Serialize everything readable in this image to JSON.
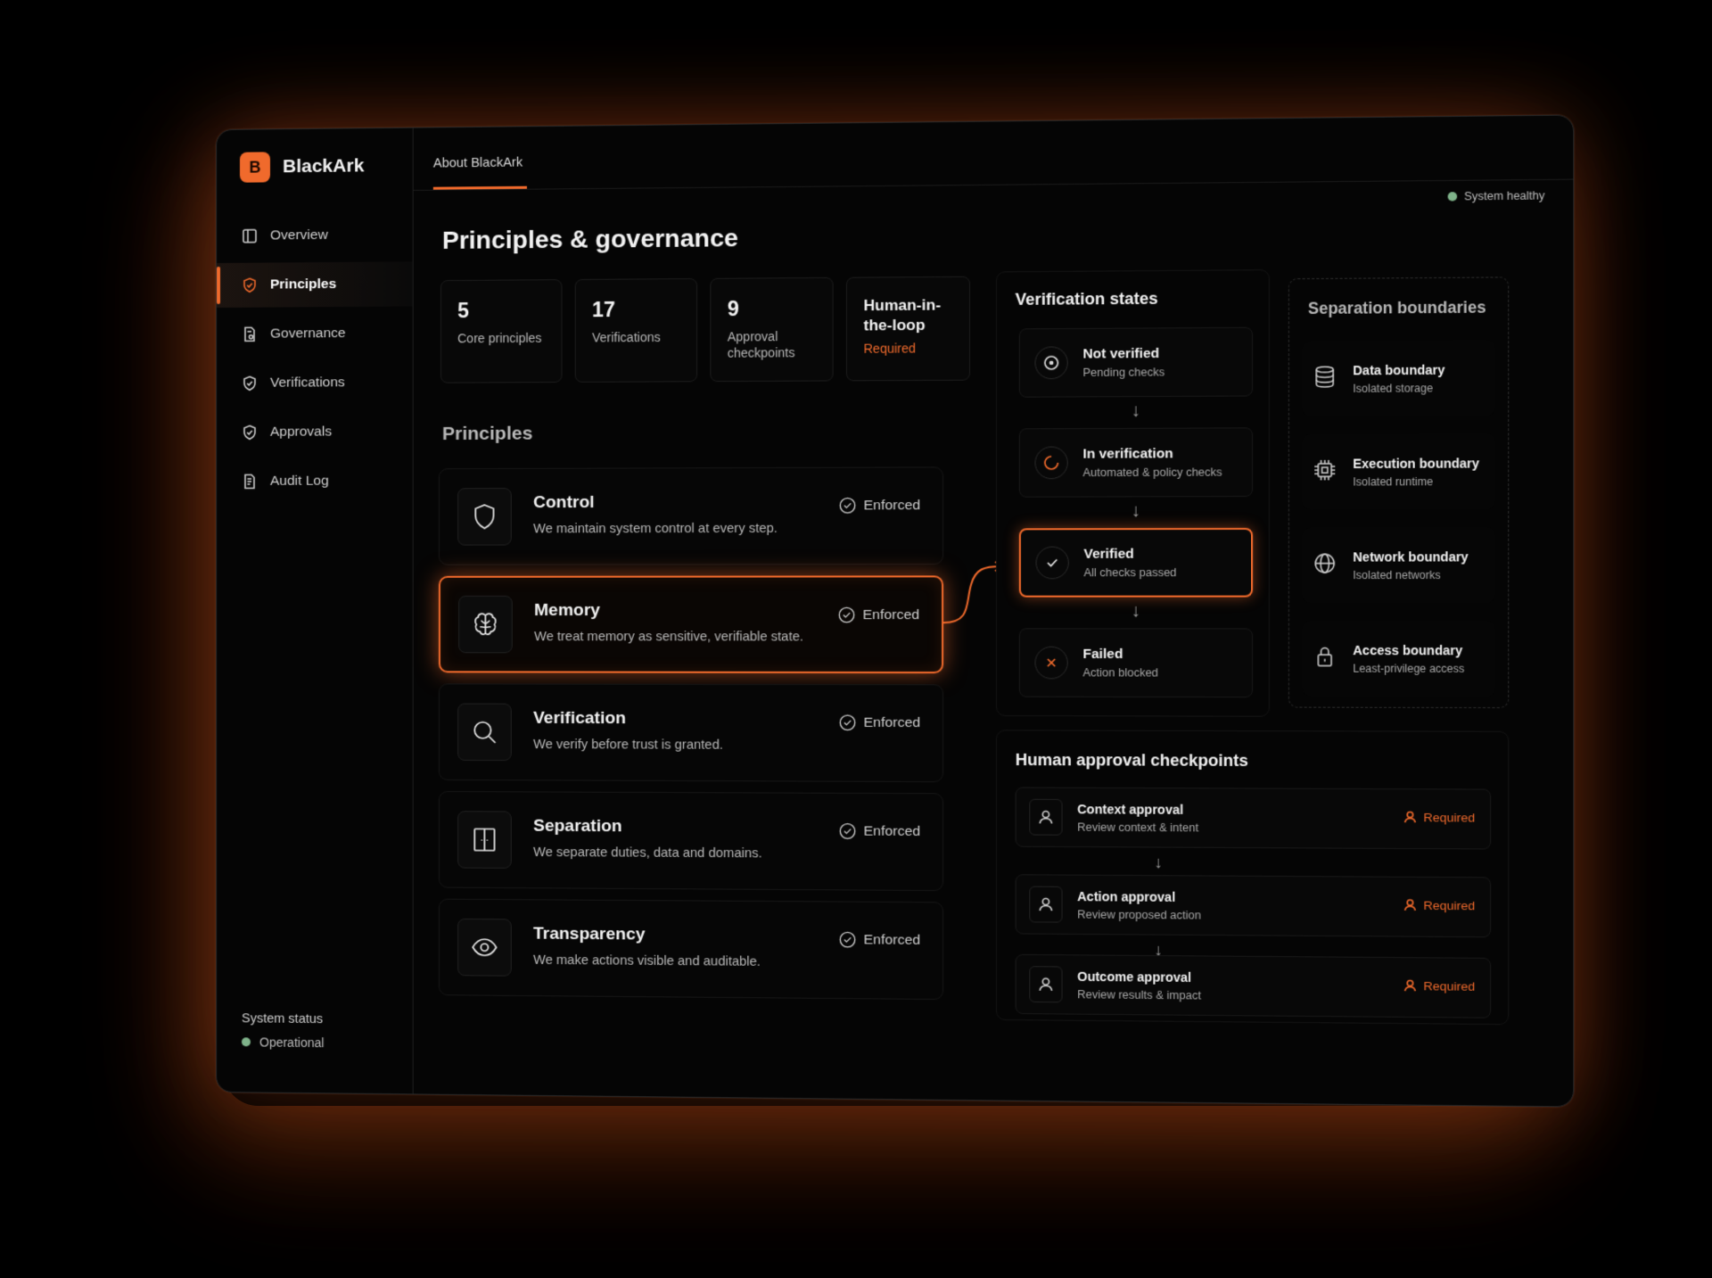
{
  "brand": {
    "logo_letter": "B",
    "name": "BlackArk"
  },
  "sidebar": {
    "items": [
      {
        "label": "Overview",
        "icon": "layout-icon"
      },
      {
        "label": "Principles",
        "icon": "shield-check-icon",
        "active": true
      },
      {
        "label": "Governance",
        "icon": "document-gear-icon"
      },
      {
        "label": "Verifications",
        "icon": "shield-icon"
      },
      {
        "label": "Approvals",
        "icon": "shield-check-icon"
      },
      {
        "label": "Audit Log",
        "icon": "document-search-icon"
      }
    ],
    "status_title": "System status",
    "status_value": "Operational"
  },
  "tabs": [
    {
      "label": "About BlackArk",
      "active": true
    }
  ],
  "health": "System healthy",
  "page_title": "Principles & governance",
  "stats": [
    {
      "value": "5",
      "label": "Core principles"
    },
    {
      "value": "17",
      "label": "Verifications"
    },
    {
      "value": "9",
      "label": "Approval checkpoints"
    },
    {
      "value": "Human-in-the-loop",
      "label": "Required"
    }
  ],
  "principles_heading": "Principles",
  "principles": [
    {
      "title": "Control",
      "desc": "We maintain system control at every step.",
      "status": "Enforced",
      "icon": "shield-icon"
    },
    {
      "title": "Memory",
      "desc": "We treat memory as sensitive, verifiable state.",
      "status": "Enforced",
      "icon": "brain-icon",
      "highlighted": true
    },
    {
      "title": "Verification",
      "desc": "We verify before trust is granted.",
      "status": "Enforced",
      "icon": "search-icon"
    },
    {
      "title": "Separation",
      "desc": "We separate duties, data and domains.",
      "status": "Enforced",
      "icon": "split-panel-icon"
    },
    {
      "title": "Transparency",
      "desc": "We make actions visible and auditable.",
      "status": "Enforced",
      "icon": "eye-icon"
    }
  ],
  "verification": {
    "title": "Verification states",
    "states": [
      {
        "name": "Not verified",
        "sub": "Pending checks",
        "icon": "target-icon"
      },
      {
        "name": "In verification",
        "sub": "Automated & policy checks",
        "icon": "spinner-icon"
      },
      {
        "name": "Verified",
        "sub": "All checks passed",
        "icon": "check-icon",
        "highlighted": true
      },
      {
        "name": "Failed",
        "sub": "Action blocked",
        "icon": "x-icon"
      }
    ]
  },
  "separation": {
    "title": "Separation boundaries",
    "items": [
      {
        "name": "Data boundary",
        "sub": "Isolated storage",
        "icon": "database-icon"
      },
      {
        "name": "Execution boundary",
        "sub": "Isolated runtime",
        "icon": "chip-icon"
      },
      {
        "name": "Network boundary",
        "sub": "Isolated networks",
        "icon": "globe-icon"
      },
      {
        "name": "Access boundary",
        "sub": "Least-privilege access",
        "icon": "lock-icon"
      }
    ]
  },
  "approvals": {
    "title": "Human approval checkpoints",
    "items": [
      {
        "name": "Context approval",
        "sub": "Review context & intent",
        "status": "Required"
      },
      {
        "name": "Action approval",
        "sub": "Review proposed action",
        "status": "Required"
      },
      {
        "name": "Outcome approval",
        "sub": "Review results & impact",
        "status": "Required"
      }
    ]
  },
  "colors": {
    "accent": "#f06a2c",
    "background": "#050505",
    "healthy": "#7fb38a"
  }
}
